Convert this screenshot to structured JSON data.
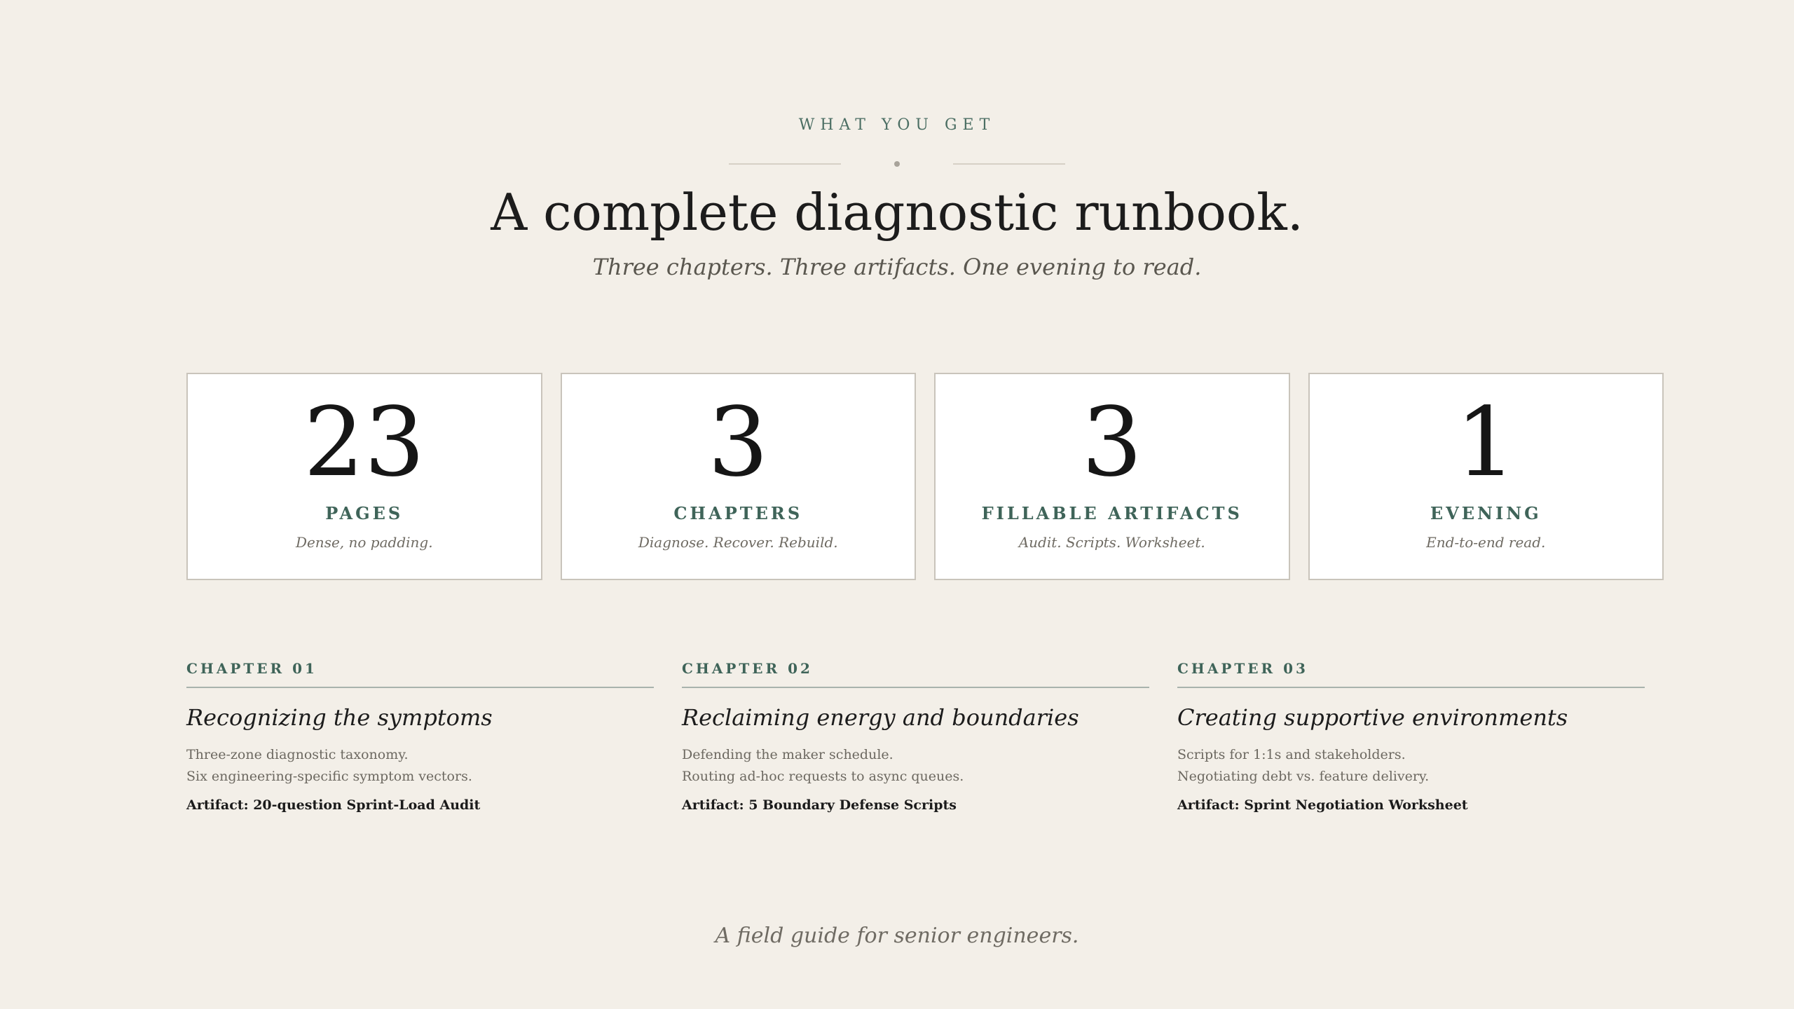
{
  "header": {
    "eyebrow": "WHAT YOU GET",
    "title": "A complete diagnostic runbook.",
    "subtitle": "Three chapters. Three artifacts. One evening to read."
  },
  "stats": [
    {
      "number": "23",
      "label": "PAGES",
      "note": "Dense, no padding."
    },
    {
      "number": "3",
      "label": "CHAPTERS",
      "note": "Diagnose. Recover. Rebuild."
    },
    {
      "number": "3",
      "label": "FILLABLE ARTIFACTS",
      "note": "Audit. Scripts. Worksheet."
    },
    {
      "number": "1",
      "label": "EVENING",
      "note": "End-to-end read."
    }
  ],
  "chapters": [
    {
      "kicker": "CHAPTER 01",
      "title": "Recognizing the symptoms",
      "line1": "Three-zone diagnostic taxonomy.",
      "line2": "Six engineering-specific symptom vectors.",
      "artifact": "Artifact: 20-question Sprint-Load Audit"
    },
    {
      "kicker": "CHAPTER 02",
      "title": "Reclaiming energy and boundaries",
      "line1": "Defending the maker schedule.",
      "line2": "Routing ad-hoc requests to async queues.",
      "artifact": "Artifact: 5 Boundary Defense Scripts"
    },
    {
      "kicker": "CHAPTER 03",
      "title": "Creating supportive environments",
      "line1": "Scripts for 1:1s and stakeholders.",
      "line2": "Negotiating debt vs. feature delivery.",
      "artifact": "Artifact: Sprint Negotiation Worksheet"
    }
  ],
  "footer": {
    "tagline": "A field guide for senior engineers."
  },
  "colors": {
    "background": "#f3efe8",
    "accent": "#3f6459",
    "card": "#ffffff",
    "text": "#1c1c1c"
  }
}
